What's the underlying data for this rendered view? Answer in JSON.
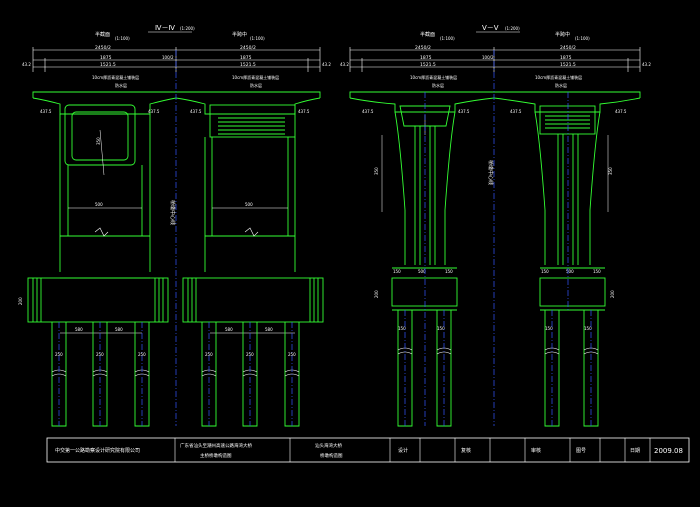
{
  "drawing": {
    "left_view": {
      "title": "Ⅳ－Ⅳ",
      "scale": "(1:200)",
      "half_left": "半截面",
      "half_left_scale": "(1:100)",
      "half_right": "半跨中",
      "half_right_scale": "(1:100)"
    },
    "right_view": {
      "title": "Ⅴ－Ⅴ",
      "scale": "(1:200)",
      "half_left": "半截面",
      "half_left_scale": "(1:100)",
      "half_right": "半跨中",
      "half_right_scale": "(1:100)"
    },
    "dims_top_left": {
      "total": "2450/2",
      "half": "2450/2",
      "d1": "1875",
      "d2": "1875",
      "d3": "1521.5",
      "d4": "1521.5",
      "edge": "43.2",
      "mid": "100/2"
    },
    "dims_top_right": {
      "total": "2450/2",
      "half": "2450/2",
      "d1": "1875",
      "d2": "1875",
      "d3": "1521.5",
      "d4": "1521.5",
      "edge": "43.2",
      "mid": "100/2"
    },
    "deck_note": "10cm厚沥青混凝土铺装层",
    "deck_note2": "防水层",
    "centerline_label": "桥墩中心线",
    "dim_side": "437.5",
    "dim_pier": "500",
    "dim_pile": "250",
    "dim_cap": "580",
    "dim_small": "150",
    "dim_vert": "200",
    "dim_h": "350"
  },
  "title_block": {
    "company": "中交第一公路勘察设计研究院有限公司",
    "project": "广东省汕头至潮州高速公路海湾大桥",
    "project2": "主桥桥墩构造图",
    "drawing_name": "汕头海湾大桥",
    "drawing_name2": "桥墩构造图",
    "design": "设计",
    "review": "复核",
    "approve": "审核",
    "sheet": "图号",
    "date_label": "日期",
    "date": "2009.08"
  }
}
